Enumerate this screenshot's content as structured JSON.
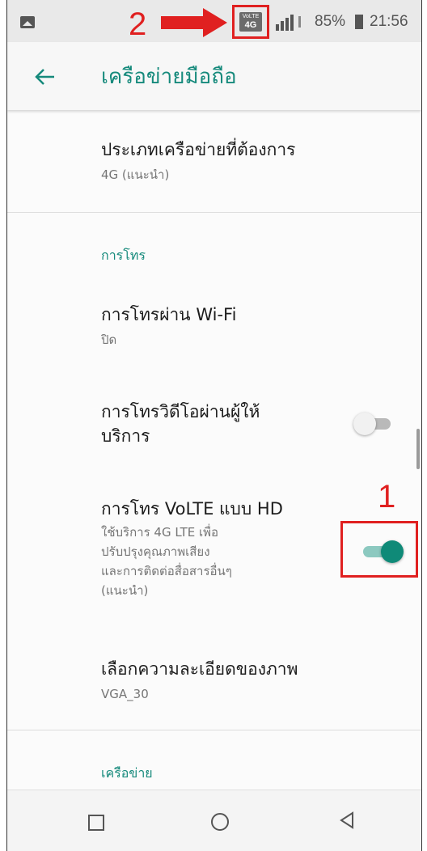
{
  "status_bar": {
    "volte_badge_top": "VoLTE",
    "volte_badge_bottom": "4G",
    "battery_percent": "85%",
    "time": "21:56",
    "icons": [
      "photo-icon",
      "signal-icon",
      "battery-icon"
    ]
  },
  "annotations": {
    "label_1": "1",
    "label_2": "2",
    "color": "#e02020"
  },
  "app_bar": {
    "title": "เครือข่ายมือถือ",
    "back_icon": "arrow-back-icon"
  },
  "settings": {
    "preferred_network": {
      "title": "ประเภทเครือข่ายที่ต้องการ",
      "summary": "4G (แนะนำ)"
    },
    "calling_header": "การโทร",
    "wifi_calling": {
      "title": "การโทรผ่าน Wi-Fi",
      "summary": "ปิด"
    },
    "video_calling": {
      "title_line1": "การโทรวิดีโอผ่านผู้ให้",
      "title_line2": "บริการ",
      "enabled": false
    },
    "volte_hd": {
      "title": "การโทร VoLTE แบบ HD",
      "summary_line1": "ใช้บริการ 4G LTE เพื่อ",
      "summary_line2": "ปรับปรุงคุณภาพเสียง",
      "summary_line3": "และการติดต่อสื่อสารอื่นๆ",
      "summary_line4": "(แนะนำ)",
      "enabled": true
    },
    "resolution": {
      "title": "เลือกความละเอียดของภาพ",
      "summary": "VGA_30"
    },
    "network_header": "เครือข่าย"
  },
  "nav_bar": {
    "icons": [
      "recent-apps-icon",
      "home-icon",
      "back-triangle-icon"
    ]
  },
  "colors": {
    "accent": "#168a7c",
    "switch_on": "#0f8a78",
    "annotation": "#e02020"
  }
}
